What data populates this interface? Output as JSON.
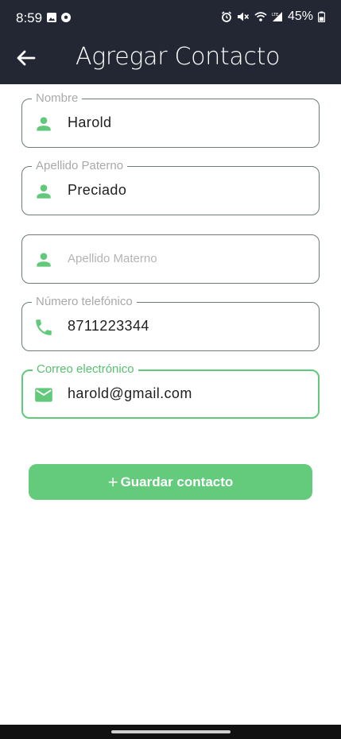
{
  "status_bar": {
    "time": "8:59",
    "battery": "45%",
    "icons": [
      "gallery-icon",
      "soccer-ball-icon",
      "alarm-icon",
      "mute-icon",
      "wifi-icon",
      "lte-signal-icon",
      "battery-icon"
    ]
  },
  "app_bar": {
    "title": "Agregar Contacto",
    "back_icon": "arrow-left-icon"
  },
  "form": {
    "nombre": {
      "label": "Nombre",
      "value": "Harold",
      "icon": "person-icon"
    },
    "apellido_paterno": {
      "label": "Apellido Paterno",
      "value": "Preciado",
      "icon": "person-icon"
    },
    "apellido_materno": {
      "placeholder": "Apellido Materno",
      "icon": "person-icon"
    },
    "telefono": {
      "label": "Número telefónico",
      "value": "8711223344",
      "icon": "phone-icon"
    },
    "correo": {
      "label": "Correo electrónico",
      "value": "harold@gmail.com",
      "icon": "email-icon"
    }
  },
  "save_button": {
    "icon": "+",
    "label": "Guardar contacto"
  },
  "colors": {
    "app_bar": "#222733",
    "accent": "#62c97a",
    "field_border": "#6b7c73",
    "label_inactive": "#a9a9a9"
  }
}
